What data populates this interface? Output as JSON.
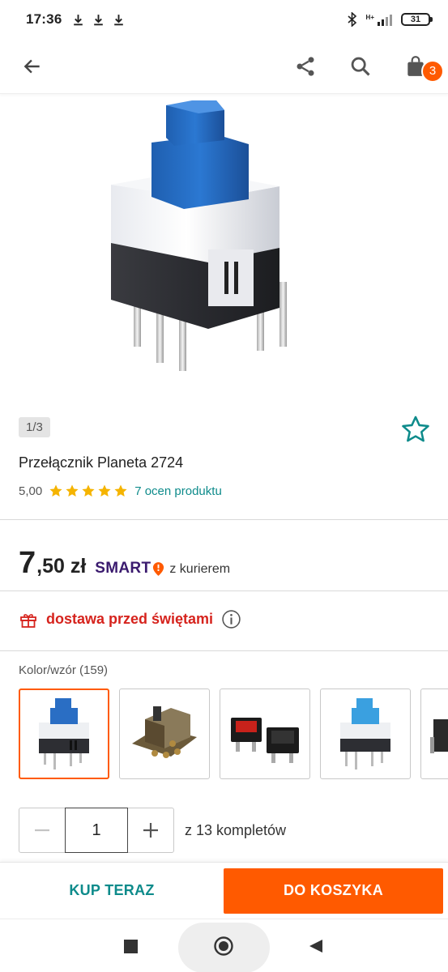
{
  "statusbar": {
    "time": "17:36",
    "network": "H+",
    "battery": "31"
  },
  "toolbar": {
    "cart_count": "3"
  },
  "gallery": {
    "pager": "1/3"
  },
  "product": {
    "title": "Przełącznik Planeta 2724",
    "rating_score": "5,00",
    "rating_value": 5,
    "rating_max": 5,
    "rating_link": "7 ocen produktu"
  },
  "price": {
    "int": "7",
    "dec": ",50 zł",
    "smart_label": "SMART",
    "courier": "z kurierem"
  },
  "delivery": {
    "text": "dostawa przed świętami"
  },
  "variants": {
    "label": "Kolor/wzór (159)"
  },
  "quantity": {
    "value": "1",
    "note": "z 13 kompletów"
  },
  "actions": {
    "buy_now": "KUP TERAZ",
    "add_to_cart": "DO KOSZYKA"
  },
  "colors": {
    "accent": "#ff5a00",
    "teal": "#0e8b8b",
    "star": "#f5b400",
    "delivery_red": "#d6231d",
    "smart_purple": "#3a1a6e"
  }
}
